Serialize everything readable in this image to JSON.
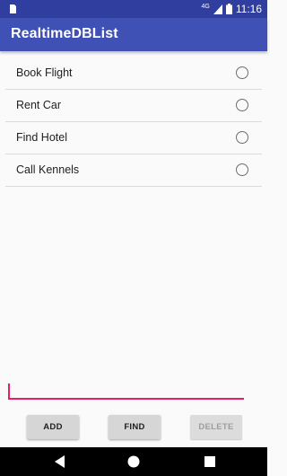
{
  "status_bar": {
    "time": "11:16",
    "network": "4G",
    "icons": [
      "notification-icon",
      "signal-icon",
      "battery-icon"
    ]
  },
  "app_bar": {
    "title": "RealtimeDBList"
  },
  "list": {
    "items": [
      {
        "label": "Book Flight",
        "checked": false
      },
      {
        "label": "Rent Car",
        "checked": false
      },
      {
        "label": "Find Hotel",
        "checked": false
      },
      {
        "label": "Call Kennels",
        "checked": false
      }
    ]
  },
  "input": {
    "value": "",
    "placeholder": ""
  },
  "buttons": {
    "add_label": "ADD",
    "find_label": "FIND",
    "delete_label": "DELETE",
    "delete_enabled": false
  },
  "nav_bar": {
    "icons": [
      "back-icon",
      "home-icon",
      "recents-icon"
    ]
  },
  "colors": {
    "primary": "#3f51b5",
    "primary_dark": "#303f9f",
    "accent": "#e91e63"
  }
}
